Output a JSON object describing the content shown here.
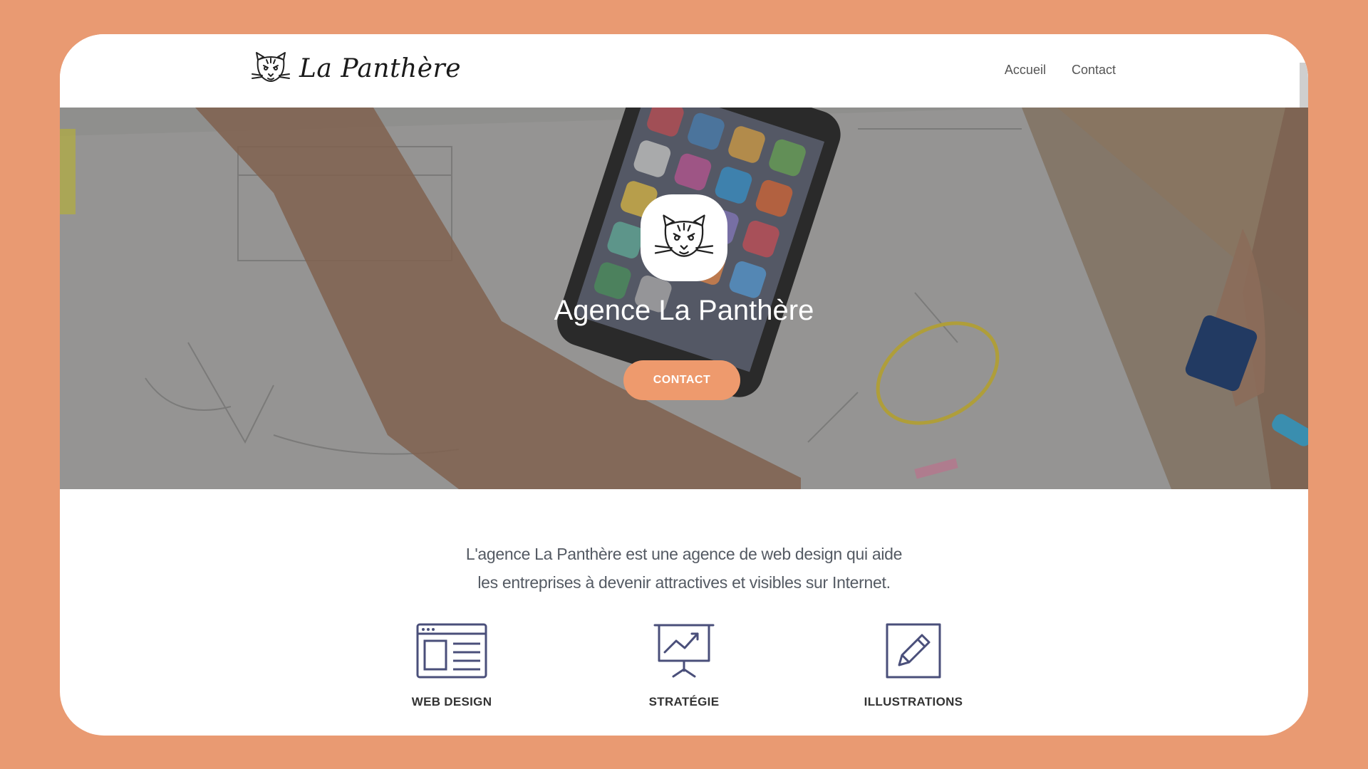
{
  "header": {
    "brand": "La Panthère",
    "tagline": "",
    "nav": [
      "Accueil",
      "Contact"
    ]
  },
  "hero": {
    "title": "Agence La Panthère",
    "cta_label": "CONTACT"
  },
  "intro": {
    "line1": "L'agence La Panthère est une agence de web design qui aide",
    "line2": "les entreprises à devenir attractives et visibles sur Internet."
  },
  "services": [
    {
      "label": "WEB DESIGN",
      "icon": "web-design-icon"
    },
    {
      "label": "STRATÉGIE",
      "icon": "strategy-presentation-icon"
    },
    {
      "label": "ILLUSTRATIONS",
      "icon": "pencil-icon"
    }
  ],
  "colors": {
    "background": "#e99a72",
    "accent": "#ee9a6d",
    "icon_stroke": "#4a4f7a",
    "text": "#545a63"
  }
}
